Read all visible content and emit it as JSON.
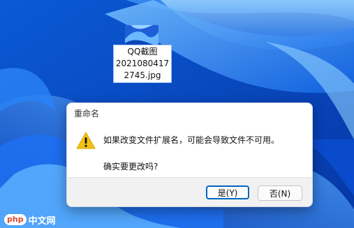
{
  "desktop": {
    "file": {
      "label_lines": [
        "QQ截图",
        "2021080417",
        "2745.jpg"
      ]
    }
  },
  "dialog": {
    "title": "重命名",
    "message": "如果改变文件扩展名，可能会导致文件不可用。",
    "question": "确实要更改吗?",
    "yes_label": "是(Y)",
    "no_label": "否(N)"
  },
  "watermark": {
    "badge": "php",
    "text": "中文网"
  }
}
